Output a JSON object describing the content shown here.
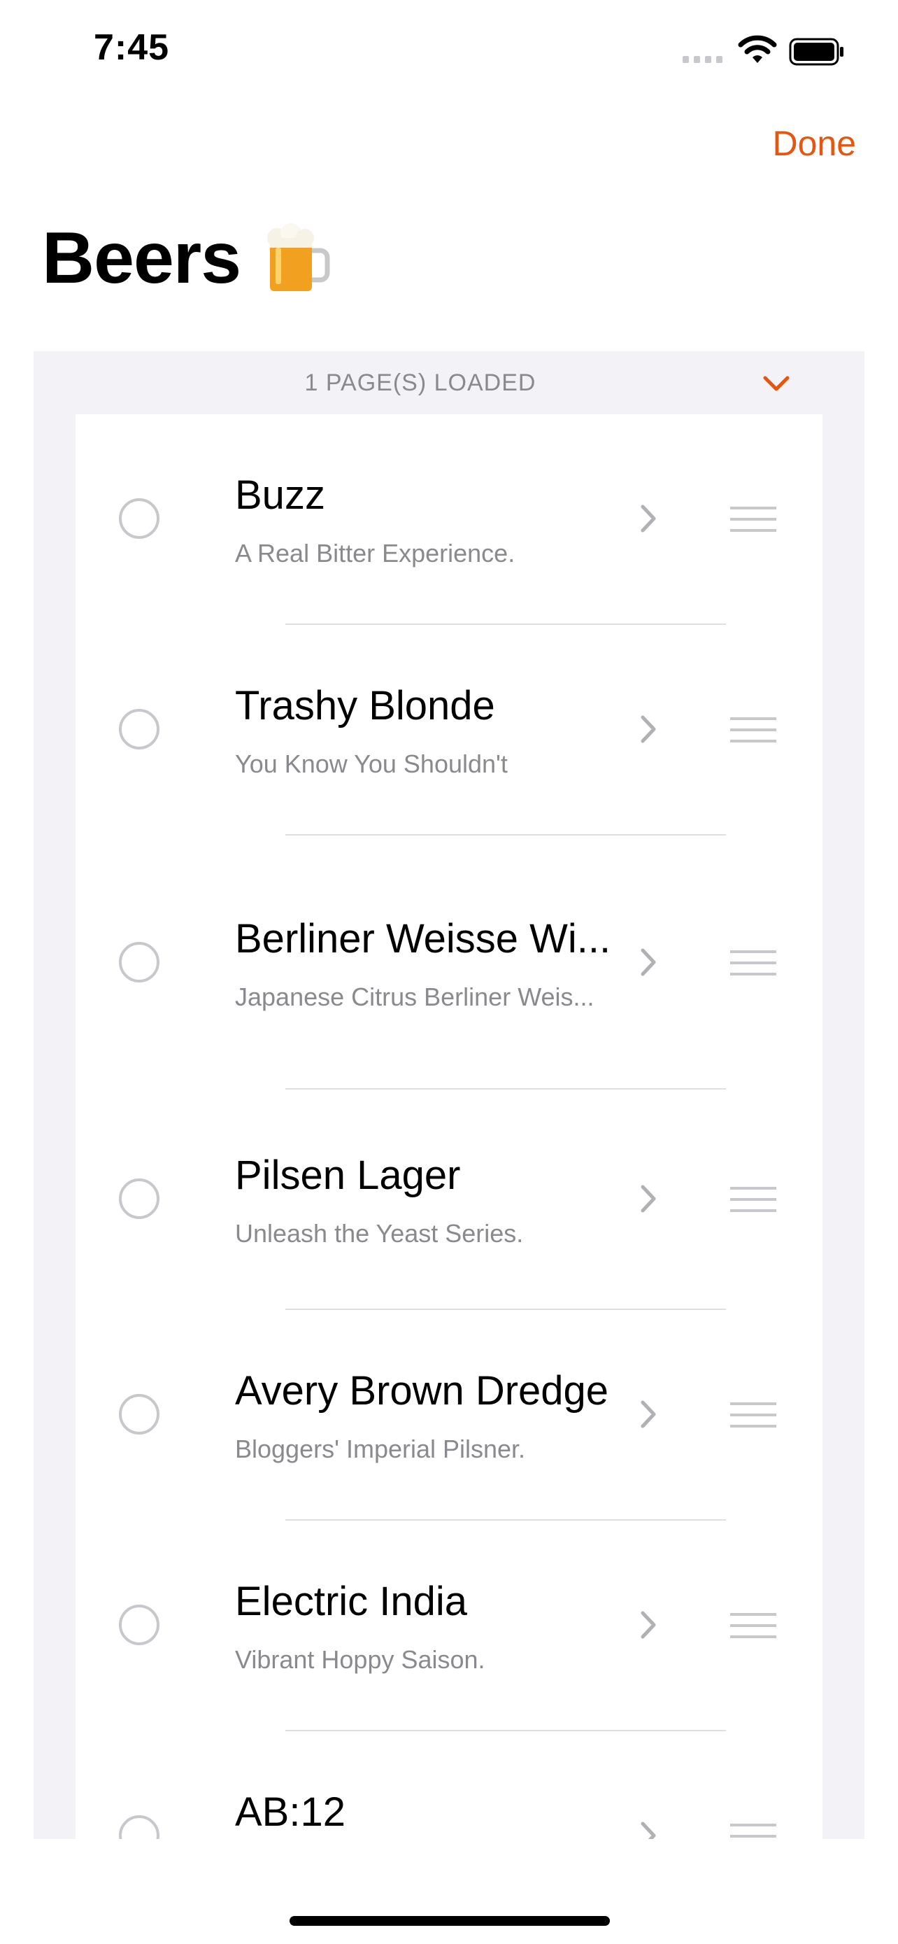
{
  "status_bar": {
    "time": "7:45"
  },
  "nav": {
    "done_label": "Done"
  },
  "page": {
    "title": "Beers",
    "title_emoji": "beer-mug-icon"
  },
  "section": {
    "header": "1 PAGE(S) LOADED",
    "collapse_icon": "chevron-down-icon"
  },
  "beers": [
    {
      "name": "Buzz",
      "tagline": "A Real Bitter Experience."
    },
    {
      "name": "Trashy Blonde",
      "tagline": "You Know You Shouldn't"
    },
    {
      "name": "Berliner Weisse Wi...",
      "tagline": "Japanese Citrus Berliner Weis..."
    },
    {
      "name": "Pilsen Lager",
      "tagline": "Unleash the Yeast Series."
    },
    {
      "name": "Avery Brown Dredge",
      "tagline": "Bloggers' Imperial Pilsner."
    },
    {
      "name": "Electric India",
      "tagline": "Vibrant Hoppy Saison."
    },
    {
      "name": "AB:12",
      "tagline": ""
    }
  ],
  "colors": {
    "accent": "#e6560f",
    "secondary_text": "#8a8a8e",
    "group_background": "#f2f2f7",
    "control_gray": "#c7c7cc"
  }
}
